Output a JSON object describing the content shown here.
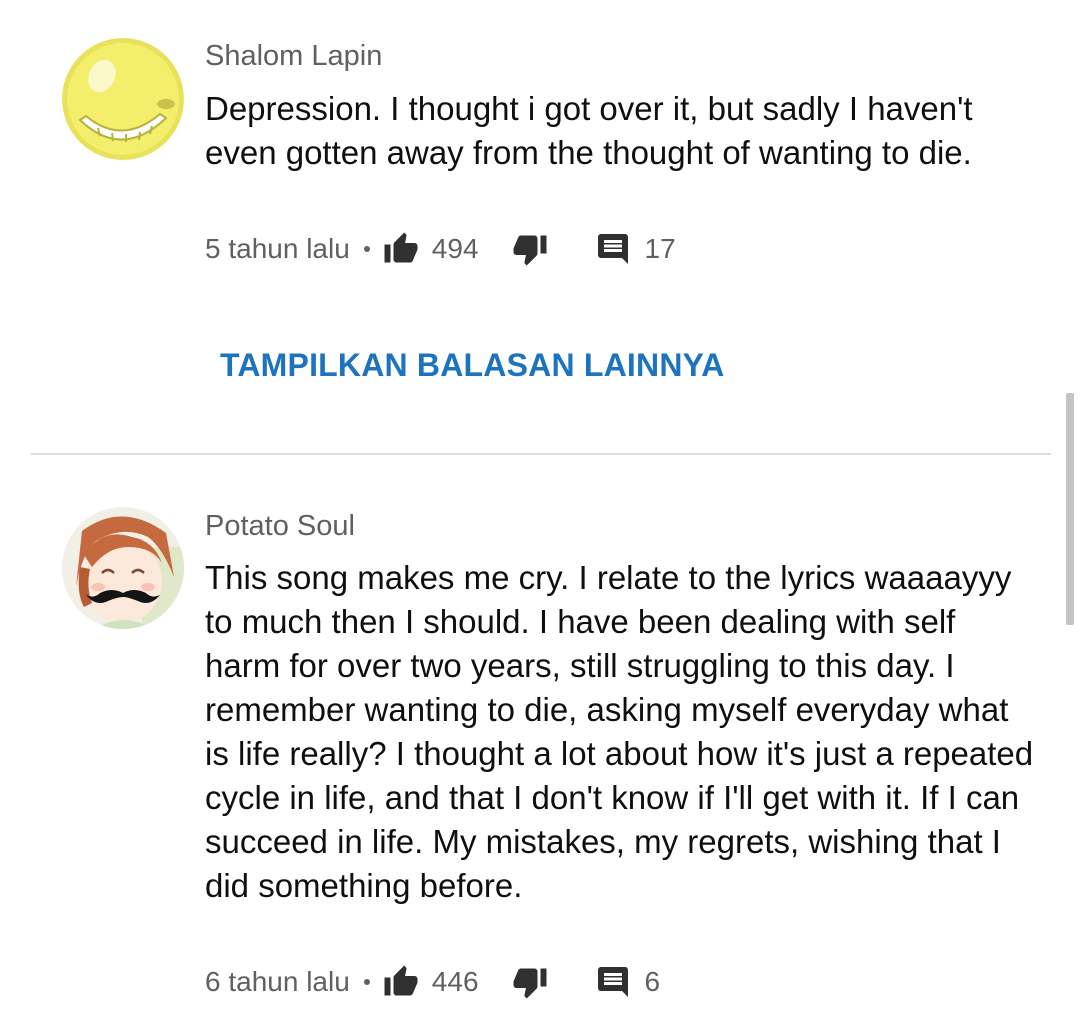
{
  "comments": [
    {
      "author": "Shalom Lapin",
      "text": "Depression. I thought i got over it, but sadly I haven't even gotten away from the thought of wanting to die.",
      "time": "5 tahun lalu",
      "likes": "494",
      "replies": "17",
      "avatar_icon": "yellow-smiley-face-icon"
    },
    {
      "author": "Potato Soul",
      "text": "This song makes me cry. I relate to the lyrics waaaayyy to much then I should. I have been dealing with self harm for over two years, still struggling to this day. I remember wanting to die, asking myself everyday what is life really? I thought a lot about how it's just a repeated cycle in life, and that I don't know if I'll get with it. If I can succeed in life. My mistakes, my regrets, wishing that I did something before.",
      "time": "6 tahun lalu",
      "likes": "446",
      "replies": "6",
      "avatar_icon": "anime-girl-mustache-icon"
    }
  ],
  "show_more_replies_label": "TAMPILKAN BALASAN LAINNYA",
  "colors": {
    "link": "#1e73be",
    "meta": "#606060",
    "divider": "#dcdcdc"
  }
}
